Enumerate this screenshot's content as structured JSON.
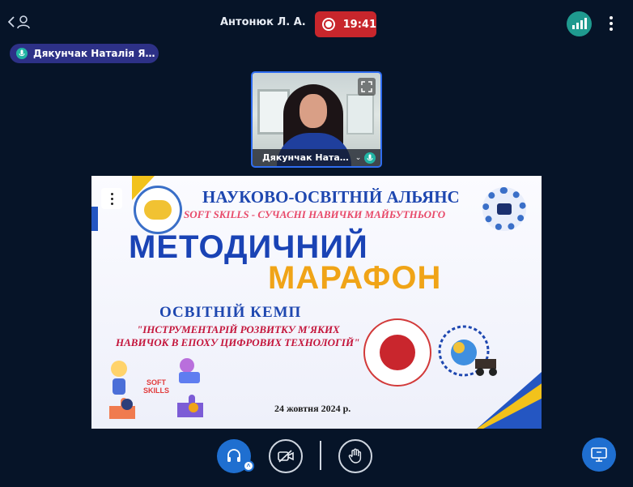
{
  "topbar": {
    "presenter_name": "Антонюк Л. А.",
    "recording_time": "19:41",
    "colors": {
      "record": "#c8262c",
      "signal": "#1f9a8f"
    },
    "icons": [
      "back-chevron-icon",
      "user-icon",
      "record-icon",
      "signal-bars-icon",
      "more-vertical-icon"
    ]
  },
  "speaker_chip": {
    "name": "Дякунчак Наталія Я…",
    "icon": "mic-icon"
  },
  "video_thumbnail": {
    "name": "Дякунчак Ната…",
    "icons": [
      "expand-icon",
      "chevron-down-icon",
      "mic-icon"
    ]
  },
  "slide": {
    "alliance_title": "НАУКОВО-ОСВІТНІЙ АЛЬЯНС",
    "alliance_subtitle": "SOFT SKILLS - СУЧАСНІ НАВИЧКИ МАЙБУТНЬОГО",
    "marathon_line1": "МЕТОДИЧНИЙ",
    "marathon_line2": "МАРАФОН",
    "camp_title": "ОСВІТНІЙ КЕМП",
    "camp_subtitle_line1": "\"ІНСТРУМЕНТАРІЙ РОЗВИТКУ М'ЯКИХ",
    "camp_subtitle_line2": "НАВИЧОК В ЕПОХУ ЦИФРОВИХ ТЕХНОЛОГІЙ\"",
    "soft_skills_label_1": "SOFT",
    "soft_skills_label_2": "SKILLS",
    "date": "24 жовтня 2024 р.",
    "colors": {
      "blue": "#1a43b5",
      "orange": "#f0a417",
      "red": "#c4163c",
      "yellow": "#f2c21b"
    }
  },
  "controls": {
    "icons": [
      "headset-icon",
      "camera-off-icon",
      "raise-hand-icon",
      "screen-share-icon"
    ],
    "accent": "#1f6fd0"
  }
}
